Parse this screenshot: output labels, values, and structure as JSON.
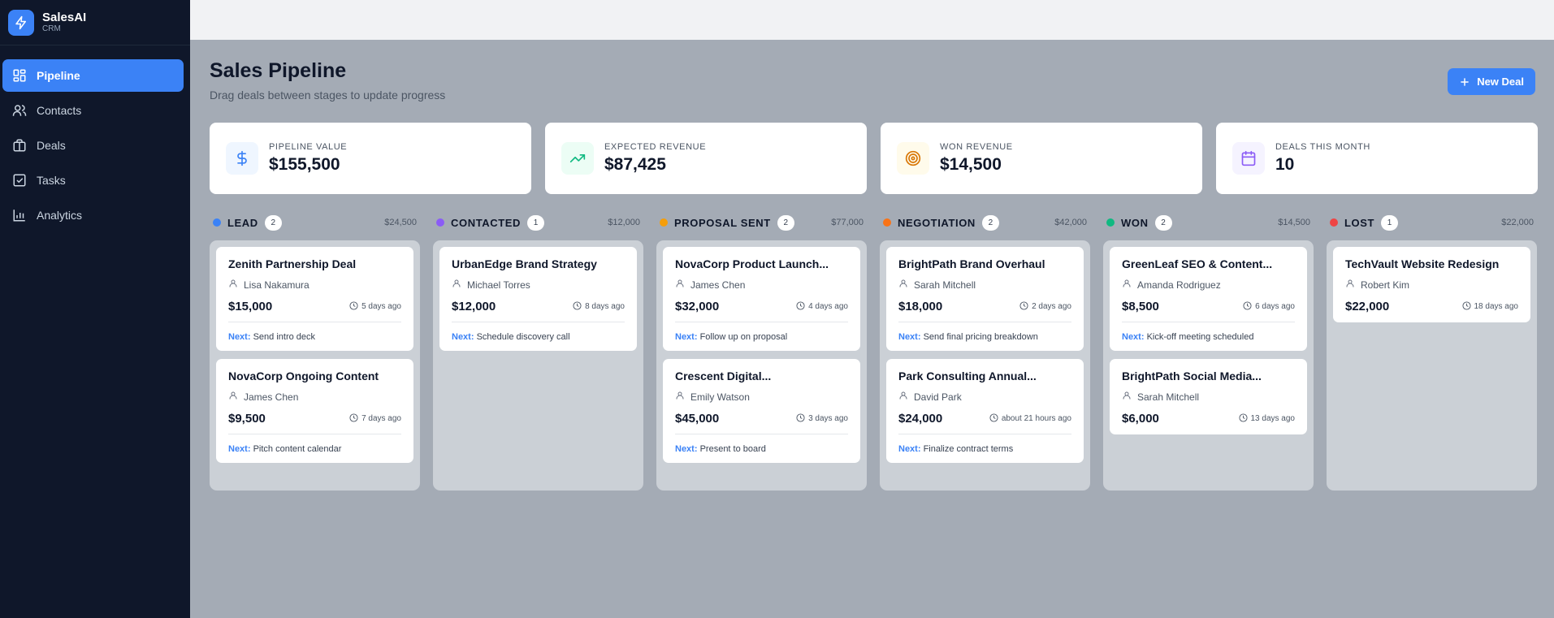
{
  "brand": {
    "name": "SalesAI",
    "sub": "CRM"
  },
  "nav": [
    {
      "label": "Pipeline",
      "icon": "grid-icon",
      "active": true
    },
    {
      "label": "Contacts",
      "icon": "users-icon"
    },
    {
      "label": "Deals",
      "icon": "briefcase-icon"
    },
    {
      "label": "Tasks",
      "icon": "checkbox-icon"
    },
    {
      "label": "Analytics",
      "icon": "bar-chart-icon"
    }
  ],
  "header": {
    "title": "Sales Pipeline",
    "subtitle": "Drag deals between stages to update progress",
    "new_deal_label": "New Deal"
  },
  "stats": [
    {
      "label": "Pipeline Value",
      "value": "$155,500",
      "icon": "dollar-icon",
      "bg": "#eff6ff",
      "fg": "#3b82f6"
    },
    {
      "label": "Expected Revenue",
      "value": "$87,425",
      "icon": "trending-up-icon",
      "bg": "#ecfdf5",
      "fg": "#10b981"
    },
    {
      "label": "Won Revenue",
      "value": "$14,500",
      "icon": "target-icon",
      "bg": "#fffbeb",
      "fg": "#d97706"
    },
    {
      "label": "Deals This Month",
      "value": "10",
      "icon": "calendar-icon",
      "bg": "#f5f3ff",
      "fg": "#8b5cf6"
    }
  ],
  "next_label": "Next:",
  "columns": [
    {
      "id": "lead",
      "title": "LEAD",
      "count": "2",
      "total": "$24,500",
      "color": "#3b82f6",
      "cards": [
        {
          "title": "Zenith Partnership Deal",
          "contact": "Lisa Nakamura",
          "amount": "$15,000",
          "time": "5 days ago",
          "next": "Send intro deck"
        },
        {
          "title": "NovaCorp Ongoing Content",
          "contact": "James Chen",
          "amount": "$9,500",
          "time": "7 days ago",
          "next": "Pitch content calendar"
        }
      ]
    },
    {
      "id": "contacted",
      "title": "CONTACTED",
      "count": "1",
      "total": "$12,000",
      "color": "#8b5cf6",
      "cards": [
        {
          "title": "UrbanEdge Brand Strategy",
          "contact": "Michael Torres",
          "amount": "$12,000",
          "time": "8 days ago",
          "next": "Schedule discovery call"
        }
      ]
    },
    {
      "id": "proposal",
      "title": "PROPOSAL SENT",
      "count": "2",
      "total": "$77,000",
      "color": "#f59e0b",
      "cards": [
        {
          "title": "NovaCorp Product Launch...",
          "contact": "James Chen",
          "amount": "$32,000",
          "time": "4 days ago",
          "next": "Follow up on proposal"
        },
        {
          "title": "Crescent Digital...",
          "contact": "Emily Watson",
          "amount": "$45,000",
          "time": "3 days ago",
          "next": "Present to board"
        }
      ]
    },
    {
      "id": "negotiation",
      "title": "NEGOTIATION",
      "count": "2",
      "total": "$42,000",
      "color": "#f97316",
      "cards": [
        {
          "title": "BrightPath Brand Overhaul",
          "contact": "Sarah Mitchell",
          "amount": "$18,000",
          "time": "2 days ago",
          "next": "Send final pricing breakdown"
        },
        {
          "title": "Park Consulting Annual...",
          "contact": "David Park",
          "amount": "$24,000",
          "time": "about 21 hours ago",
          "next": "Finalize contract terms"
        }
      ]
    },
    {
      "id": "won",
      "title": "WON",
      "count": "2",
      "total": "$14,500",
      "color": "#10b981",
      "cards": [
        {
          "title": "GreenLeaf SEO & Content...",
          "contact": "Amanda Rodriguez",
          "amount": "$8,500",
          "time": "6 days ago",
          "next": "Kick-off meeting scheduled"
        },
        {
          "title": "BrightPath Social Media...",
          "contact": "Sarah Mitchell",
          "amount": "$6,000",
          "time": "13 days ago",
          "next": ""
        }
      ]
    },
    {
      "id": "lost",
      "title": "LOST",
      "count": "1",
      "total": "$22,000",
      "color": "#ef4444",
      "cards": [
        {
          "title": "TechVault Website Redesign",
          "contact": "Robert Kim",
          "amount": "$22,000",
          "time": "18 days ago",
          "next": ""
        }
      ]
    }
  ]
}
